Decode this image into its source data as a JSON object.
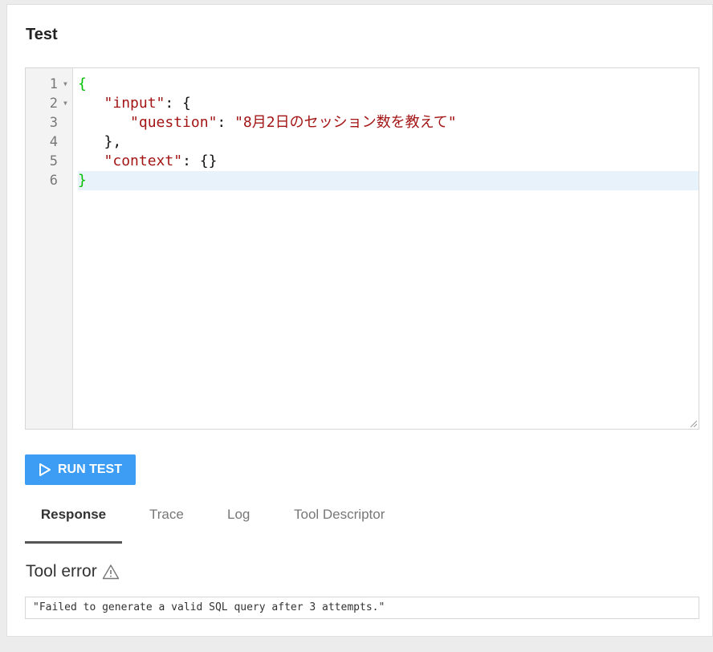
{
  "section_title": "Test",
  "editor": {
    "line_numbers": [
      "1",
      "2",
      "3",
      "4",
      "5",
      "6"
    ],
    "lines": {
      "l1_brace": "{",
      "l2_key": "\"input\"",
      "l2_rest": ": {",
      "l3_key": "\"question\"",
      "l3_colon": ": ",
      "l3_value": "\"8月2日のセッション数を教えて\"",
      "l4": "},",
      "l5_key": "\"context\"",
      "l5_rest": ": {}",
      "l6_brace": "}"
    }
  },
  "run_button": {
    "label": "RUN TEST",
    "icon": "play-icon"
  },
  "tabs": [
    "Response",
    "Trace",
    "Log",
    "Tool Descriptor"
  ],
  "active_tab": "Response",
  "result": {
    "heading": "Tool error",
    "icon": "warning-icon",
    "message": "\"Failed to generate a valid SQL query after 3 attempts.\""
  },
  "colors": {
    "accent": "#3d9df4",
    "brace": "#00c000",
    "string": "#a31515",
    "active_line": "#e8f2fb"
  }
}
